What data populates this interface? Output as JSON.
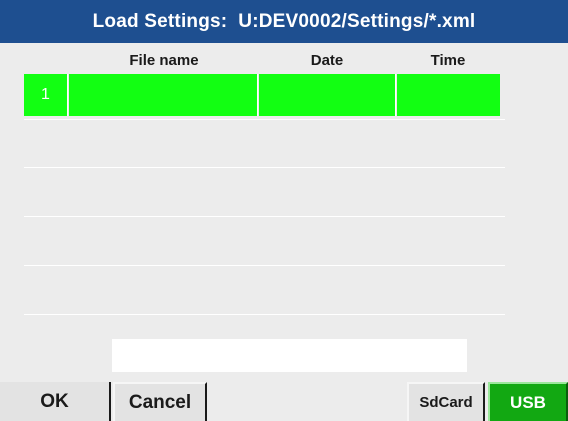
{
  "title": "Load Settings:  U:DEV0002/Settings/*.xml",
  "table": {
    "columns": [
      "File name",
      "Date",
      "Time"
    ],
    "rows": [
      {
        "index": "1",
        "file_name": "",
        "date": "",
        "time": "",
        "selected": true
      }
    ],
    "empty_rows_visible": 4
  },
  "filename_input": {
    "value": "",
    "placeholder": ""
  },
  "buttons": {
    "ok": "OK",
    "cancel": "Cancel",
    "sdcard": "SdCard",
    "usb": "USB"
  },
  "colors": {
    "title_bar": "#1e4f90",
    "selected_row": "#12ff12",
    "active_source": "#12a812",
    "background": "#ececec"
  }
}
